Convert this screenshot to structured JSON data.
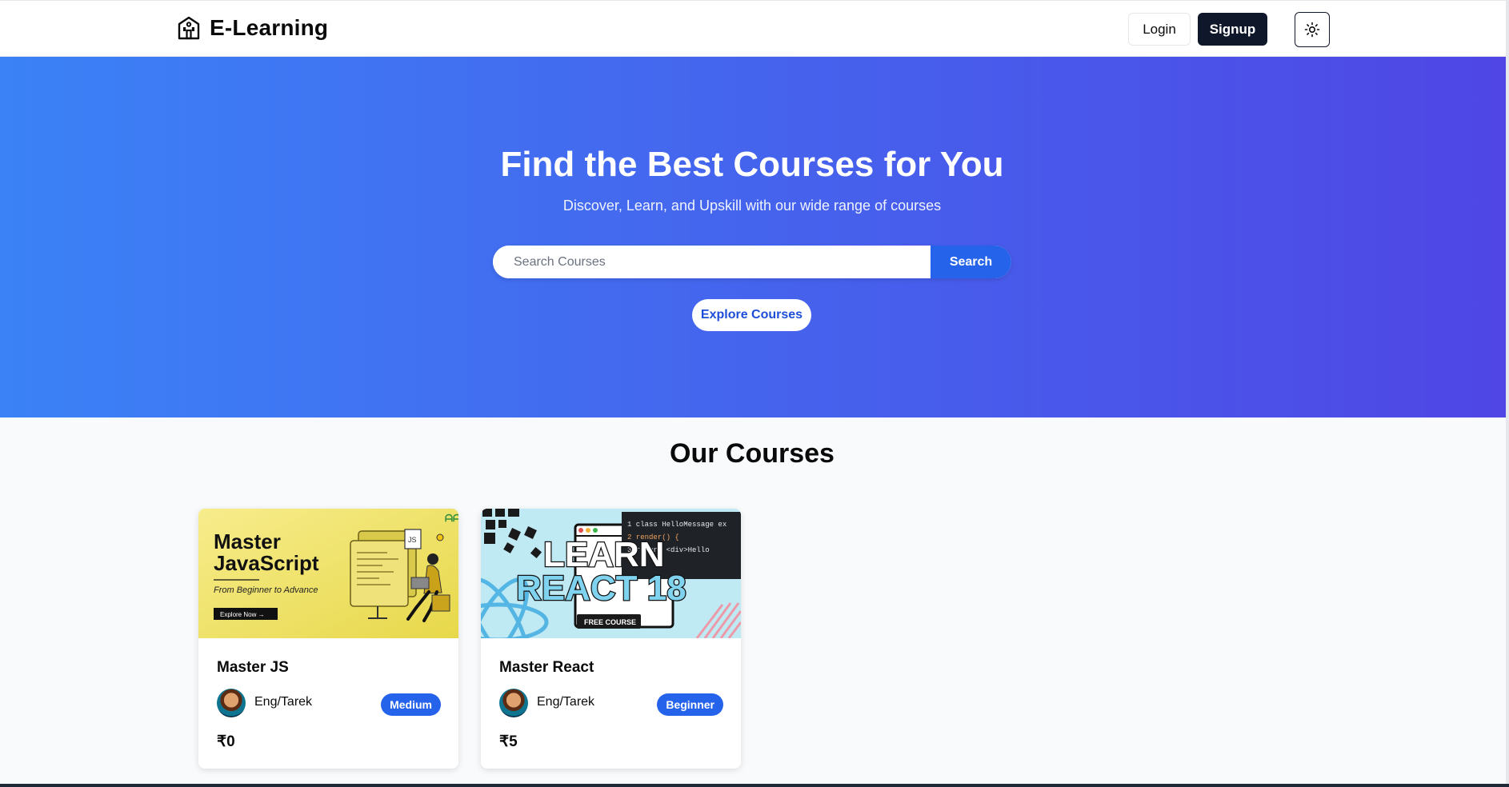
{
  "nav": {
    "brand": "E-Learning",
    "login_label": "Login",
    "signup_label": "Signup",
    "theme_icon": "sun-icon"
  },
  "hero": {
    "title": "Find the Best Courses for You",
    "subtitle": "Discover, Learn, and Upskill with our wide range of courses",
    "search_placeholder": "Search Courses",
    "search_label": "Search",
    "explore_label": "Explore Courses"
  },
  "courses": {
    "section_title": "Our Courses",
    "items": [
      {
        "title": "Master JS",
        "author": "Eng/Tarek",
        "level": "Medium",
        "price": "₹0",
        "thumb": {
          "heading_line1": "Master",
          "heading_line2": "JavaScript",
          "tagline": "From Beginner to Advance",
          "cta": "Explore Now →",
          "badge": "JS"
        }
      },
      {
        "title": "Master React",
        "author": "Eng/Tarek",
        "level": "Beginner",
        "price": "₹5",
        "thumb": {
          "line1": "LEARN",
          "line2": "REACT 18",
          "tag": "FREE COURSE",
          "code1": "1 class HelloMessage ex",
          "code2": "2   render() {",
          "code3": "3     return <div>Hello"
        }
      }
    ]
  },
  "colors": {
    "hero_start": "#3b82f6",
    "hero_end": "#4f46e5",
    "accent": "#2563eb",
    "dark": "#0f172a"
  }
}
